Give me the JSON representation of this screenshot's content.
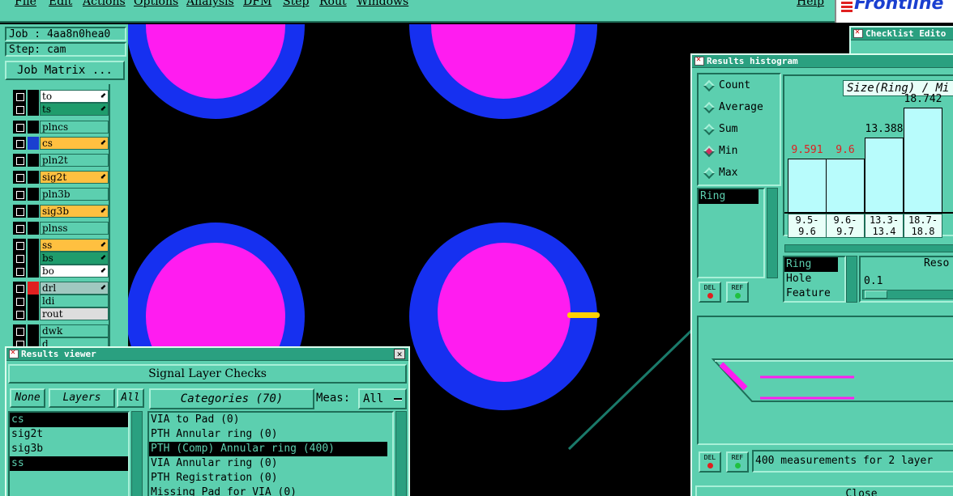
{
  "menubar": {
    "items": [
      "File",
      "Edit",
      "Actions",
      "Options",
      "Analysis",
      "DFM",
      "Step",
      "Rout",
      "Windows"
    ],
    "help": "Help",
    "logo_text": "Frontline"
  },
  "left_panel": {
    "job_label": "Job : 4aa8n0hea0",
    "step_label": "Step: cam",
    "job_matrix_button": "Job Matrix ...",
    "layers": [
      {
        "name": "to",
        "bg": "#ffffff",
        "color": "#000000",
        "arrow": true
      },
      {
        "name": "ts",
        "bg": "#1f9c6c",
        "color": "#000000",
        "arrow": true
      },
      {
        "name": "plncs",
        "bg": "#5ccfaf",
        "color": "#000000",
        "arrow": false
      },
      {
        "name": "cs",
        "bg": "#ffc040",
        "color": "#1a3fd0",
        "arrow": true
      },
      {
        "name": "pln2t",
        "bg": "#5ccfaf",
        "color": "#000000",
        "arrow": false
      },
      {
        "name": "sig2t",
        "bg": "#ffc040",
        "color": "#000000",
        "arrow": true
      },
      {
        "name": "pln3b",
        "bg": "#5ccfaf",
        "color": "#000000",
        "arrow": false
      },
      {
        "name": "sig3b",
        "bg": "#ffc040",
        "color": "#000000",
        "arrow": true
      },
      {
        "name": "plnss",
        "bg": "#5ccfaf",
        "color": "#000000",
        "arrow": false
      },
      {
        "name": "ss",
        "bg": "#ffc040",
        "color": "#000000",
        "arrow": true
      },
      {
        "name": "bs",
        "bg": "#1f9c6c",
        "color": "#000000",
        "arrow": true
      },
      {
        "name": "bo",
        "bg": "#ffffff",
        "color": "#000000",
        "arrow": true
      },
      {
        "name": "drl",
        "bg": "#a0c8c0",
        "color": "#e02020",
        "arrow": true
      },
      {
        "name": "ldi",
        "bg": "#5ccfaf",
        "color": "#000000",
        "arrow": false
      },
      {
        "name": "rout",
        "bg": "#dddddd",
        "color": "#000000",
        "arrow": false
      },
      {
        "name": "dwk",
        "bg": "#5ccfaf",
        "color": "#000000",
        "arrow": false
      },
      {
        "name": "d",
        "bg": "#5ccfaf",
        "color": "#000000",
        "arrow": false
      }
    ]
  },
  "results_viewer": {
    "title": "Results viewer",
    "header": "Signal Layer Checks",
    "none_btn": "None",
    "layers_btn": "Layers",
    "all_btn": "All",
    "categories_btn": "Categories (70)",
    "meas_label": "Meas:",
    "meas_value": "All",
    "layer_list": [
      {
        "name": "cs",
        "selected": true
      },
      {
        "name": "sig2t",
        "selected": false
      },
      {
        "name": "sig3b",
        "selected": false
      },
      {
        "name": "ss",
        "selected": true
      }
    ],
    "category_list": [
      {
        "name": "VIA to Pad (0)",
        "selected": false
      },
      {
        "name": "PTH Annular ring (0)",
        "selected": false
      },
      {
        "name": "PTH (Comp) Annular ring (400)",
        "selected": true
      },
      {
        "name": "VIA Annular ring (0)",
        "selected": false
      },
      {
        "name": "PTH Registration (0)",
        "selected": false
      },
      {
        "name": "Missing Pad for VIA (0)",
        "selected": false
      }
    ]
  },
  "checklist_editor": {
    "title": "Checklist Edito"
  },
  "histogram": {
    "title": "Results histogram",
    "modes": [
      "Count",
      "Average",
      "Sum",
      "Min",
      "Max"
    ],
    "selected_mode": "Min",
    "ring_list_item": "Ring",
    "chart_title": "Size(Ring) / Mi",
    "bars": [
      {
        "value": "9.591",
        "bin": [
          "9.5-",
          "9.6"
        ],
        "red": true
      },
      {
        "value": "9.6",
        "bin": [
          "9.6-",
          "9.7"
        ],
        "red": true
      },
      {
        "value": "13.388",
        "bin": [
          "13.3-",
          "13.4"
        ],
        "red": false
      },
      {
        "value": "18.742",
        "bin": [
          "18.7-",
          "18.8"
        ],
        "red": false
      }
    ],
    "field_list": [
      {
        "name": "Ring",
        "selected": true
      },
      {
        "name": "Hole",
        "selected": false
      },
      {
        "name": "Feature",
        "selected": false
      }
    ],
    "reso_label": "Reso",
    "reso_value": "0.1",
    "del_label": "DEL",
    "ref_label": "REF",
    "status": "400 measurements for 2 layer",
    "close_btn": "Close"
  },
  "colors": {
    "panel": "#5ccfaf",
    "pad_outer": "#1630f0",
    "pad_inner": "#ff1cf0",
    "trace": "#ffd000",
    "pointer_line": "#1a7a6a",
    "pointer_line_light": "#40e0e0"
  }
}
